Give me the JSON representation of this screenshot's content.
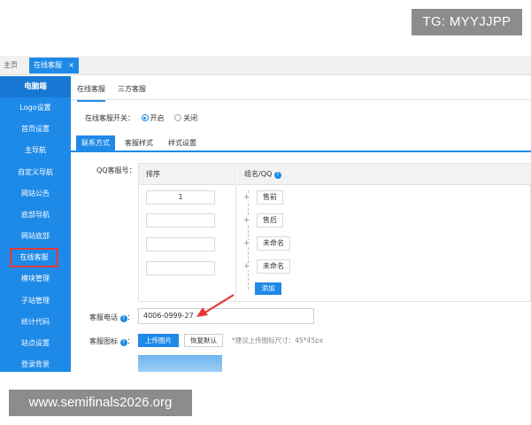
{
  "watermarks": {
    "top": "TG: MYYJJPP",
    "bottom": "www.semifinals2026.org"
  },
  "tabbar": {
    "home": "主页",
    "active_tab": "在线客服",
    "close_glyph": "×"
  },
  "sidebar": {
    "header": "电脑端",
    "items": [
      {
        "label": "Logo设置"
      },
      {
        "label": "首页设置"
      },
      {
        "label": "主导航"
      },
      {
        "label": "自定义导航"
      },
      {
        "label": "网站公告"
      },
      {
        "label": "底部导航"
      },
      {
        "label": "网站底部"
      },
      {
        "label": "在线客服"
      },
      {
        "label": "模块管理"
      },
      {
        "label": "子站管理"
      },
      {
        "label": "统计代码"
      },
      {
        "label": "站点设置"
      },
      {
        "label": "登录背景"
      }
    ],
    "selected_index": 7
  },
  "subtabs": {
    "online": "在线客服",
    "third_party": "三方客服"
  },
  "switch": {
    "label": "在线客服开关：",
    "on": "开启",
    "off": "关闭",
    "selected": "开启"
  },
  "inner_tabs": {
    "contact": "联系方式",
    "style": "客服样式",
    "theme": "样式设置"
  },
  "qq": {
    "label": "QQ客服号：",
    "col_sort": "排序",
    "col_group": "组名/QQ",
    "help": "?",
    "rows": [
      {
        "sort": "1",
        "group": "售前"
      },
      {
        "sort": "",
        "group": "售后"
      },
      {
        "sort": "",
        "group": "未命名"
      },
      {
        "sort": "",
        "group": "未命名"
      }
    ],
    "add_label": "添加"
  },
  "phone": {
    "label": "客服电话",
    "help": "?",
    "colon": "：",
    "value": "4006-0999-27"
  },
  "icon_setting": {
    "label": "客服图标",
    "help": "?",
    "colon": "：",
    "upload": "上传图片",
    "restore": "恢复默认",
    "hint": "*建议上传图标尺寸：45*45px"
  },
  "colors": {
    "accent": "#1e8ae8",
    "sidebar_header": "#1778d4",
    "highlight": "#e53935"
  },
  "icons": {
    "expand": "plus-icon",
    "annotation": "red-arrow"
  }
}
